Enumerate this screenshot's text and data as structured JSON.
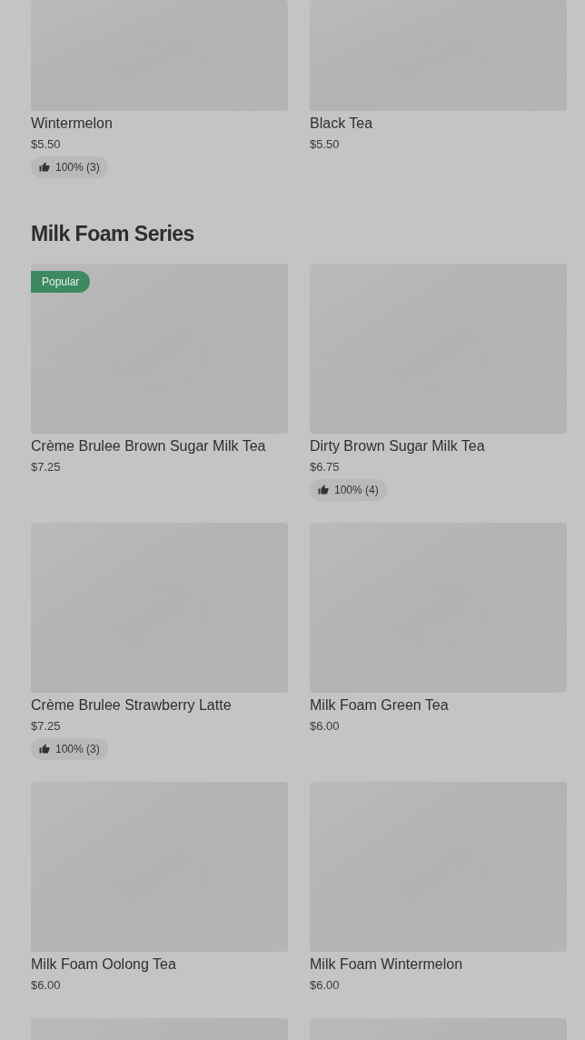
{
  "top_items": [
    {
      "kind": "product",
      "name": "Wintermelon",
      "price": "$5.50",
      "rating": "100% (3)"
    },
    {
      "kind": "product",
      "name": "Black Tea",
      "price": "$5.50"
    }
  ],
  "sections": [
    {
      "title": "Milk Foam Series",
      "items": [
        {
          "kind": "product",
          "name": "Crème Brulee Brown Sugar Milk Tea",
          "price": "$7.25",
          "badge": "Popular"
        },
        {
          "kind": "product",
          "name": "Dirty Brown Sugar Milk Tea",
          "price": "$6.75",
          "rating": "100% (4)"
        },
        {
          "kind": "product",
          "name": "Crème Brulee Strawberry Latte",
          "price": "$7.25",
          "rating": "100% (3)"
        },
        {
          "kind": "product",
          "name": "Milk Foam Green Tea",
          "price": "$6.00"
        },
        {
          "kind": "product",
          "name": "Milk Foam Oolong Tea",
          "price": "$6.00"
        },
        {
          "kind": "product",
          "name": "Milk Foam Wintermelon",
          "price": "$6.00"
        },
        {
          "kind": "picture"
        },
        {
          "kind": "picture"
        }
      ]
    }
  ]
}
